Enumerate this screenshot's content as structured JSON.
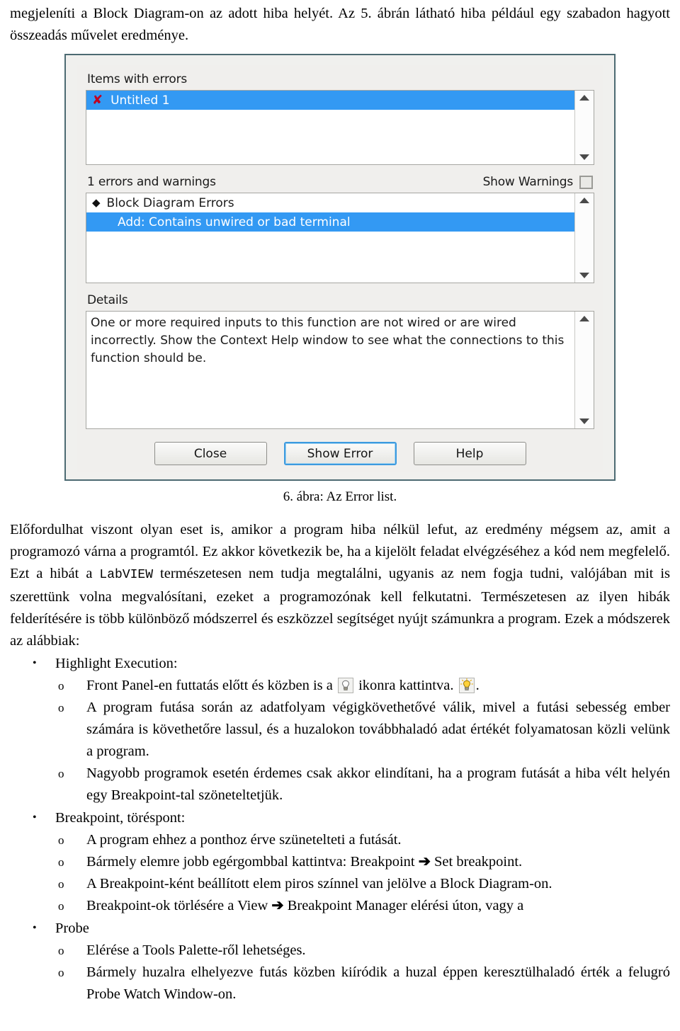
{
  "intro": {
    "text": "megjeleníti a Block Diagram-on az adott hiba helyét. Az 5. ábrán látható hiba például egy szabadon hagyott összeadás művelet eredménye."
  },
  "dialog": {
    "items_label": "Items with errors",
    "items": [
      {
        "icon": "error-x-icon",
        "icon_glyph": "✘",
        "label": "Untitled 1",
        "selected": true
      }
    ],
    "errors_label": "1 errors and warnings",
    "show_warnings_label": "Show Warnings",
    "show_warnings_checked": false,
    "error_tree": [
      {
        "bullet": "◆",
        "label": "Block Diagram Errors",
        "selected": false,
        "indent": 0
      },
      {
        "bullet": "",
        "label": "Add: Contains unwired or bad terminal",
        "selected": true,
        "indent": 1
      }
    ],
    "details_label": "Details",
    "details_text": "One or more required inputs to this function are not wired or are wired incorrectly. Show the Context Help window to see what the connections to this function should be.",
    "buttons": [
      {
        "label": "Close",
        "focused": false
      },
      {
        "label": "Show Error",
        "focused": true
      },
      {
        "label": "Help",
        "focused": false
      }
    ],
    "colors": {
      "selection_blue": "#3399f3",
      "error_red": "#c00020",
      "border": "#4c6a72",
      "focus_ring": "#3c9adf"
    }
  },
  "figure_caption": "6. ábra: Az Error list.",
  "body_paragraph": {
    "part1": "Előfordulhat viszont olyan eset is, amikor a program hiba nélkül lefut, az eredmény mégsem az, amit a programozó várna a programtól. Ez akkor következik be, ha a kijelölt feladat elvégzéséhez a kód nem megfelelő. Ezt a hibát a ",
    "mono": "LabVIEW",
    "part2": " természetesen nem tudja megtalálni, ugyanis az nem fogja tudni, valójában mit is szerettünk volna megvalósítani, ezeket a programozónak kell felkutatni. Természetesen az ilyen hibák felderítésére is több különböző módszerrel és eszközzel segítséget nyújt számunkra a program. Ezek a módszerek az alábbiak:"
  },
  "lists": {
    "bullet1": "•",
    "bullet2": "o",
    "groups": [
      {
        "title": "Highlight Execution:",
        "items": [
          {
            "pre": "Front Panel-en futtatás előtt és közben is a ",
            "icon1": "lightbulb-off-icon",
            "mid": " ikonra kattintva. ",
            "icon2": "lightbulb-on-icon",
            "post": "."
          },
          {
            "pre": "A program futása során az adatfolyam végigkövethetővé válik, mivel a futási sebesség ember számára is követhetőre lassul, és a huzalokon továbbhaladó adat értékét folyamatosan közli velünk a program."
          },
          {
            "pre": "Nagyobb programok esetén érdemes csak akkor elindítani, ha a program futását a hiba vélt helyén egy Breakpoint-tal szöneteltetjük."
          }
        ]
      },
      {
        "title": "Breakpoint, töréspont:",
        "items": [
          {
            "pre": "A program ehhez a ponthoz érve szünetelteti a futását."
          },
          {
            "pre": "Bármely elemre jobb egérgombbal kattintva: Breakpoint ",
            "arrow": "➔",
            "post": " Set breakpoint."
          },
          {
            "pre": "A Breakpoint-ként beállított elem piros színnel van jelölve a Block Diagram-on."
          },
          {
            "pre": "Breakpoint-ok törlésére a View ",
            "arrow": "➔",
            "post": " Breakpoint Manager elérési úton, vagy a"
          }
        ]
      },
      {
        "title": "Probe",
        "items": [
          {
            "pre": "Elérése a Tools Palette-ről lehetséges."
          },
          {
            "pre": "Bármely huzalra elhelyezve futás közben kiíródik a huzal éppen keresztülhaladó érték a felugró Probe Watch Window-on."
          }
        ]
      }
    ]
  }
}
